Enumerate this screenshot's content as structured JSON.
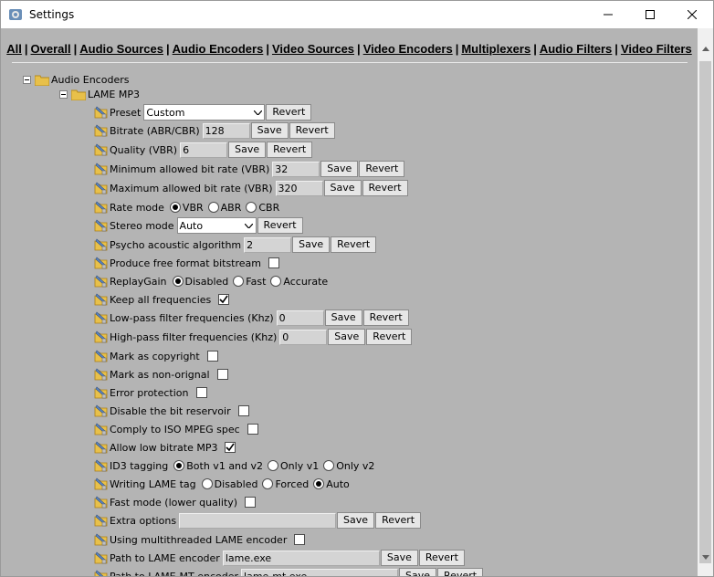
{
  "window": {
    "title": "Settings",
    "icon": "settings-app-icon"
  },
  "nav": [
    {
      "label": "All",
      "name": "nav-all"
    },
    {
      "label": "Overall",
      "name": "nav-overall"
    },
    {
      "label": "Audio Sources",
      "name": "nav-audio-sources"
    },
    {
      "label": "Audio Encoders",
      "name": "nav-audio-encoders"
    },
    {
      "label": "Video Sources",
      "name": "nav-video-sources"
    },
    {
      "label": "Video Encoders",
      "name": "nav-video-encoders"
    },
    {
      "label": "Multiplexers",
      "name": "nav-multiplexers"
    },
    {
      "label": "Audio Filters",
      "name": "nav-audio-filters"
    },
    {
      "label": "Video Filters",
      "name": "nav-video-filters"
    }
  ],
  "nav_separator": "|",
  "tree": {
    "root": "Audio Encoders",
    "child": "LAME MP3"
  },
  "buttons": {
    "save": "Save",
    "revert": "Revert"
  },
  "settings": {
    "preset": {
      "label": "Preset",
      "value": "Custom"
    },
    "bitrate": {
      "label": "Bitrate (ABR/CBR)",
      "value": "128"
    },
    "quality": {
      "label": "Quality (VBR)",
      "value": "6"
    },
    "min_bitrate": {
      "label": "Minimum allowed bit rate (VBR)",
      "value": "32"
    },
    "max_bitrate": {
      "label": "Maximum allowed bit rate (VBR)",
      "value": "320"
    },
    "rate_mode": {
      "label": "Rate mode",
      "options": [
        "VBR",
        "ABR",
        "CBR"
      ],
      "selected": "VBR"
    },
    "stereo_mode": {
      "label": "Stereo mode",
      "value": "Auto"
    },
    "psycho": {
      "label": "Psycho acoustic algorithm",
      "value": "2"
    },
    "free_format": {
      "label": "Produce free format bitstream",
      "checked": false
    },
    "replaygain": {
      "label": "ReplayGain",
      "options": [
        "Disabled",
        "Fast",
        "Accurate"
      ],
      "selected": "Disabled"
    },
    "keep_freq": {
      "label": "Keep all frequencies",
      "checked": true
    },
    "lowpass": {
      "label": "Low-pass filter frequencies (Khz)",
      "value": "0"
    },
    "highpass": {
      "label": "High-pass filter frequencies (Khz)",
      "value": "0"
    },
    "copyright": {
      "label": "Mark as copyright",
      "checked": false
    },
    "non_original": {
      "label": "Mark as non-orignal",
      "checked": false
    },
    "error_protection": {
      "label": "Error protection",
      "checked": false
    },
    "disable_reservoir": {
      "label": "Disable the bit reservoir",
      "checked": false
    },
    "iso_mpeg": {
      "label": "Comply to ISO MPEG spec",
      "checked": false
    },
    "low_bitrate": {
      "label": "Allow low bitrate MP3",
      "checked": true
    },
    "id3": {
      "label": "ID3 tagging",
      "options": [
        "Both v1 and v2",
        "Only v1",
        "Only v2"
      ],
      "selected": "Both v1 and v2"
    },
    "lame_tag": {
      "label": "Writing LAME tag",
      "options": [
        "Disabled",
        "Forced",
        "Auto"
      ],
      "selected": "Auto"
    },
    "fast_mode": {
      "label": "Fast mode (lower quality)",
      "checked": false
    },
    "extra": {
      "label": "Extra options",
      "value": ""
    },
    "multithread": {
      "label": "Using multithreaded LAME encoder",
      "checked": false
    },
    "path": {
      "label": "Path to LAME encoder",
      "value": "lame.exe"
    },
    "path_mt": {
      "label": "Path to LAME-MT encoder",
      "value": "lame-mt.exe"
    }
  }
}
